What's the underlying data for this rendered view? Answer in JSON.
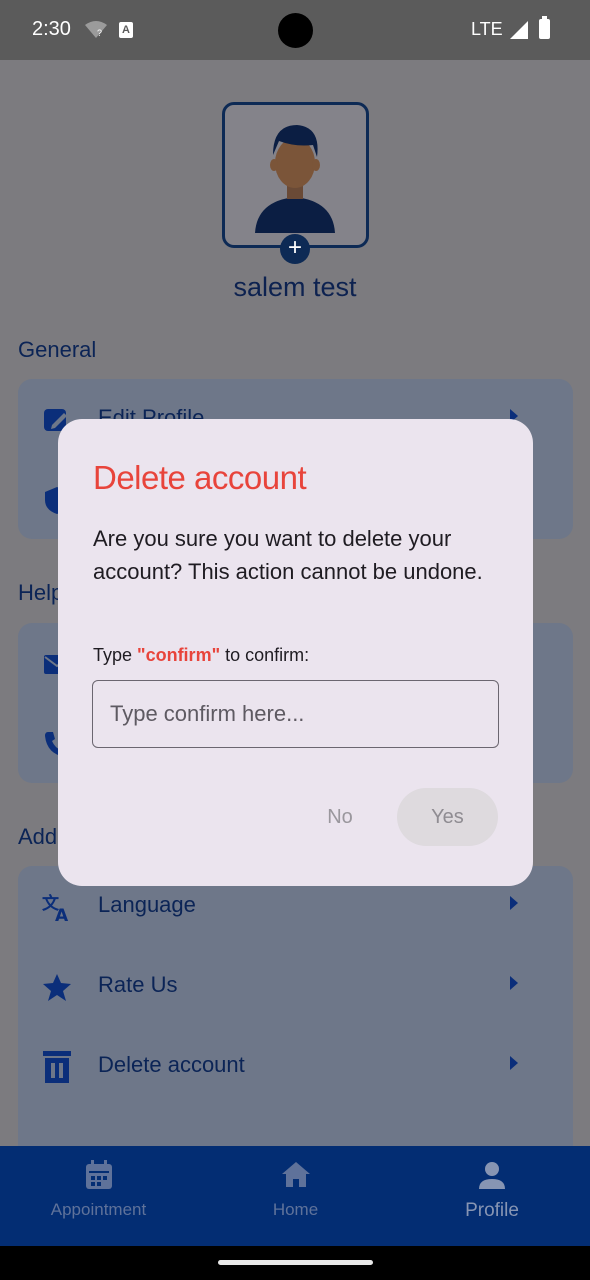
{
  "status_bar": {
    "time": "2:30",
    "network": "LTE"
  },
  "profile": {
    "user_name": "salem test"
  },
  "sections": {
    "general": {
      "title": "General",
      "items": [
        {
          "label": "Edit Profile"
        }
      ]
    },
    "help": {
      "title": "Help"
    },
    "additional": {
      "title": "Add",
      "items": [
        {
          "label": "Language"
        },
        {
          "label": "Rate Us"
        },
        {
          "label": "Delete account"
        }
      ]
    }
  },
  "dialog": {
    "title": "Delete account",
    "message": "Are you sure you want to delete your account? This action cannot be undone.",
    "hint_prefix": "Type ",
    "hint_keyword": "\"confirm\"",
    "hint_suffix": " to confirm:",
    "input_value": "",
    "input_placeholder": "Type confirm here...",
    "no_label": "No",
    "yes_label": "Yes"
  },
  "bottom_nav": {
    "items": [
      {
        "label": "Appointment"
      },
      {
        "label": "Home"
      },
      {
        "label": "Profile"
      }
    ],
    "active": "Profile"
  },
  "colors": {
    "accent_red": "#e8443b",
    "nav_blue": "#032d73",
    "dialog_bg": "#ebe4ee"
  }
}
